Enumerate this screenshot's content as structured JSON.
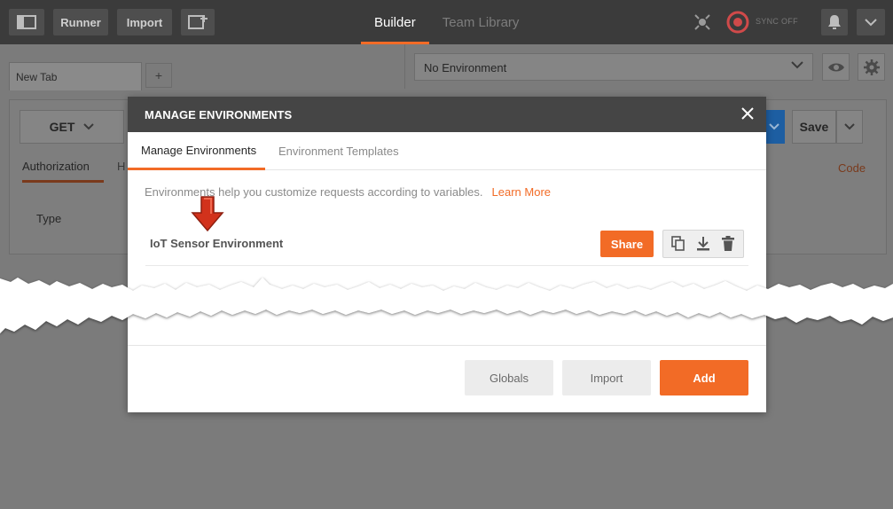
{
  "topbar": {
    "runner_label": "Runner",
    "import_label": "Import",
    "tabs": [
      {
        "label": "Builder",
        "active": true
      },
      {
        "label": "Team Library",
        "active": false
      }
    ],
    "sync_label": "SYNC OFF",
    "accent_color": "#f26b26"
  },
  "workspace": {
    "request_tab_label": "New Tab",
    "new_tab_label": "+",
    "environment_select": "No Environment",
    "method": "GET",
    "save_label": "Save",
    "auth_tab_label": "Authorization",
    "headers_tab_label": "H",
    "code_link": "Code",
    "type_label": "Type"
  },
  "modal": {
    "title": "MANAGE ENVIRONMENTS",
    "tabs": [
      {
        "label": "Manage Environments",
        "active": true
      },
      {
        "label": "Environment Templates",
        "active": false
      }
    ],
    "help_text": "Environments help you customize requests according to variables.",
    "learn_more": "Learn More",
    "environments": [
      {
        "name": "IoT Sensor Environment",
        "share_label": "Share",
        "actions": [
          "duplicate-icon",
          "download-icon",
          "delete-icon"
        ]
      }
    ],
    "footer": {
      "globals_label": "Globals",
      "import_label": "Import",
      "add_label": "Add"
    }
  }
}
